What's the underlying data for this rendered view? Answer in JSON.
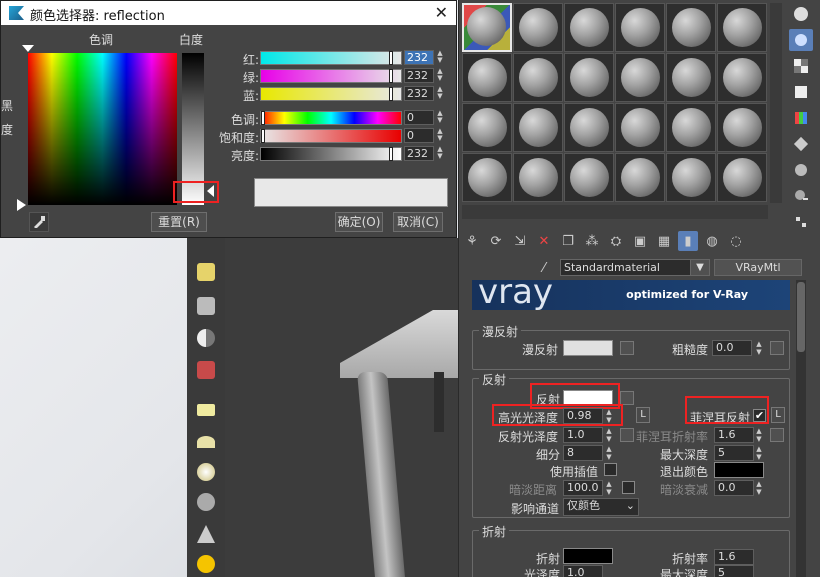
{
  "dialog": {
    "title": "颜色选择器: reflection",
    "close_glyph": "✕",
    "hue_label": "色调",
    "whiteness_label": "白度",
    "black_label": "黑",
    "degree_label": "度",
    "sliders": [
      {
        "label": "红:",
        "value": "232",
        "selected": true
      },
      {
        "label": "绿:",
        "value": "232",
        "selected": false
      },
      {
        "label": "蓝:",
        "value": "232",
        "selected": false
      },
      {
        "label": "色调:",
        "value": "0",
        "selected": false
      },
      {
        "label": "饱和度:",
        "value": "0",
        "selected": false
      },
      {
        "label": "亮度:",
        "value": "232",
        "selected": false
      }
    ],
    "preview_color": "#e8e8e8",
    "reset_label": "重置(R)",
    "ok_label": "确定(O)",
    "cancel_label": "取消(C)"
  },
  "material_editor": {
    "material_name": "Standardmaterial",
    "material_type": "VRayMtl",
    "banner_logo": "vray",
    "banner_tagline": "optimized for V-Ray",
    "diffuse_group": {
      "title": "漫反射",
      "diffuse_label": "漫反射",
      "roughness_label": "粗糙度",
      "roughness_value": "0.0"
    },
    "reflection_group": {
      "title": "反射",
      "reflect_label": "反射",
      "hilight_gloss_label": "高光光泽度",
      "hilight_gloss_value": "0.98",
      "refl_gloss_label": "反射光泽度",
      "refl_gloss_value": "1.0",
      "subdivs_label": "细分",
      "subdivs_value": "8",
      "use_interp_label": "使用插值",
      "dim_distance_label": "暗淡距离",
      "dim_distance_value": "100.0",
      "affect_channels_label": "影响通道",
      "affect_channels_value": "仅颜色",
      "fresnel_label": "菲涅耳反射",
      "fresnel_ior_label": "菲涅耳折射率",
      "fresnel_ior_value": "1.6",
      "max_depth_label": "最大深度",
      "max_depth_value": "5",
      "exit_color_label": "退出颜色",
      "dim_falloff_label": "暗淡衰减",
      "dim_falloff_value": "0.0",
      "lock_label": "L"
    },
    "refraction_group": {
      "title": "折射",
      "refract_label": "折射",
      "gloss_label": "光泽度",
      "gloss_value": "1.0",
      "ior_label": "折射率",
      "ior_value": "1.6",
      "max_depth_label": "最大深度",
      "max_depth_value": "5"
    }
  },
  "colors": {
    "accent": "#5a7fb8",
    "highlight_box": "#e22222",
    "reflect_swatch": "#ffffff",
    "diffuse_swatch": "#e0e0e0",
    "exit_color_swatch": "#000000"
  }
}
